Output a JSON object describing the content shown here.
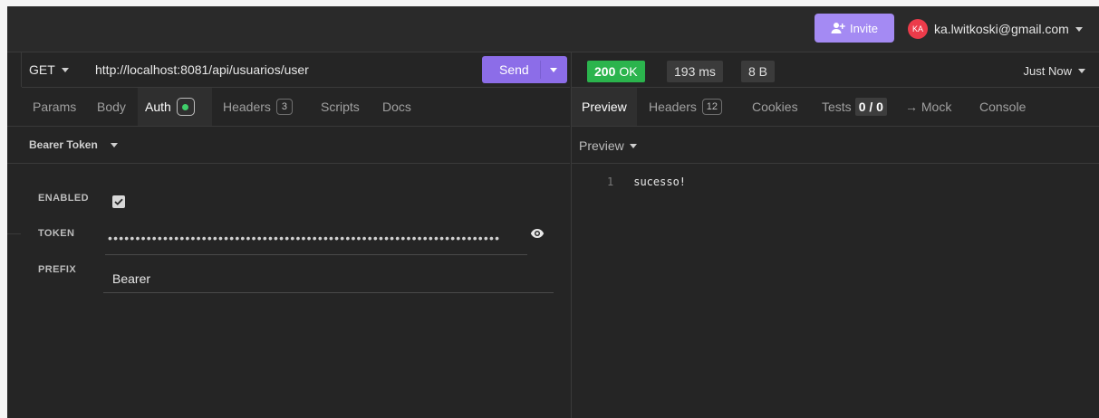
{
  "header": {
    "invite_label": "Invite",
    "user": {
      "initials": "KA",
      "email": "ka.lwitkoski@gmail.com"
    }
  },
  "request": {
    "method": "GET",
    "url": "http://localhost:8081/api/usuarios/user",
    "send_label": "Send",
    "tabs": [
      {
        "label": "Params"
      },
      {
        "label": "Body"
      },
      {
        "label": "Auth",
        "active": true
      },
      {
        "label": "Headers",
        "count": "3"
      },
      {
        "label": "Scripts"
      },
      {
        "label": "Docs"
      }
    ],
    "auth": {
      "type": "Bearer Token",
      "enabled_label": "ENABLED",
      "enabled": true,
      "token_label": "TOKEN",
      "token_masked": "•••••••••••••••••••••••••••••••••••••••••••••••••••••••••••••••••••••••",
      "prefix_label": "PREFIX",
      "prefix_value": "Bearer"
    }
  },
  "response": {
    "status_code": "200",
    "status_text": "OK",
    "time": "193 ms",
    "size": "8 B",
    "timestamp": "Just Now",
    "tabs": [
      {
        "label": "Preview",
        "active": true
      },
      {
        "label": "Headers",
        "count": "12"
      },
      {
        "label": "Cookies"
      },
      {
        "label": "Tests",
        "value": "0 / 0"
      },
      {
        "label": "→ Mock"
      },
      {
        "label": "Console"
      }
    ],
    "preview_mode": "Preview",
    "body_lines": [
      {
        "number": "1",
        "text": "sucesso!"
      }
    ]
  },
  "colors": {
    "accent": "#8c6de8",
    "invite": "#a48af3",
    "status_ok": "#2bb44d",
    "auth_dot": "#3fcf6a",
    "avatar": "#ec3b4a"
  }
}
